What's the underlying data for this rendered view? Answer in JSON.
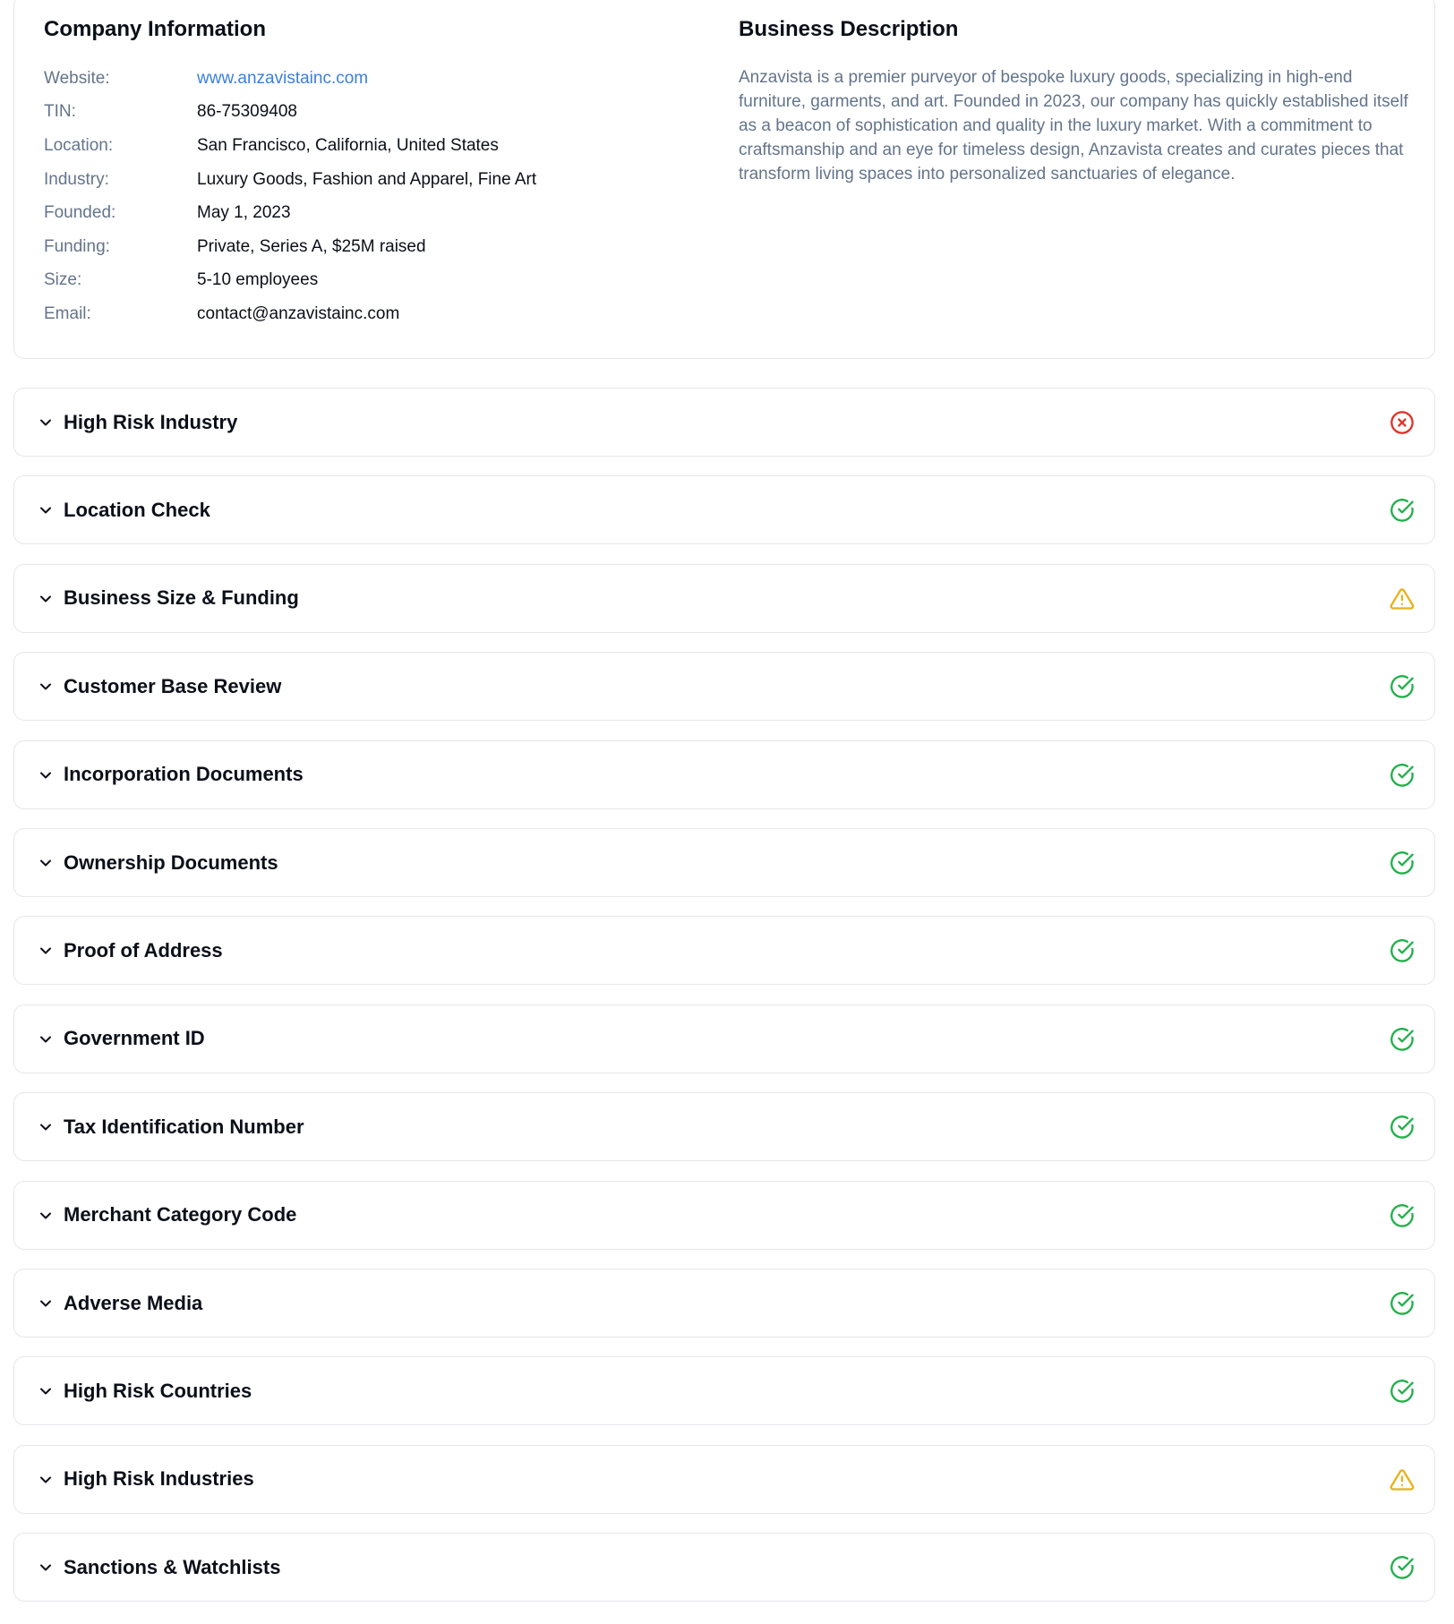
{
  "company_info": {
    "heading": "Company Information",
    "rows": [
      {
        "label": "Website:",
        "value": "www.anzavistainc.com"
      },
      {
        "label": "TIN:",
        "value": "86-75309408"
      },
      {
        "label": "Location:",
        "value": "San Francisco, California, United States"
      },
      {
        "label": "Industry:",
        "value": "Luxury Goods, Fashion and Apparel, Fine Art"
      },
      {
        "label": "Founded:",
        "value": "May 1, 2023"
      },
      {
        "label": "Funding:",
        "value": "Private, Series A, $25M raised"
      },
      {
        "label": "Size:",
        "value": "5-10 employees"
      },
      {
        "label": "Email:",
        "value": "contact@anzavistainc.com"
      }
    ]
  },
  "business_description": {
    "heading": "Business Description",
    "text": "Anzavista is a premier purveyor of bespoke luxury goods, specializing in high-end furniture, garments, and art. Founded in 2023, our company has quickly established itself as a beacon of sophistication and quality in the luxury market. With a commitment to craftsmanship and an eye for timeless design, Anzavista creates and curates pieces that transform living spaces into personalized sanctuaries of elegance."
  },
  "checks": [
    {
      "title": "High Risk Industry",
      "status": "fail",
      "icon": "x-circle-icon"
    },
    {
      "title": "Location Check",
      "status": "pass",
      "icon": "check-circle-icon"
    },
    {
      "title": "Business Size & Funding",
      "status": "warning",
      "icon": "warning-triangle-icon"
    },
    {
      "title": "Customer Base Review",
      "status": "pass",
      "icon": "check-circle-icon"
    },
    {
      "title": "Incorporation Documents",
      "status": "pass",
      "icon": "check-circle-icon"
    },
    {
      "title": "Ownership Documents",
      "status": "pass",
      "icon": "check-circle-icon"
    },
    {
      "title": "Proof of Address",
      "status": "pass",
      "icon": "check-circle-icon"
    },
    {
      "title": "Government ID",
      "status": "pass",
      "icon": "check-circle-icon"
    },
    {
      "title": "Tax Identification Number",
      "status": "pass",
      "icon": "check-circle-icon"
    },
    {
      "title": "Merchant Category Code",
      "status": "pass",
      "icon": "check-circle-icon"
    },
    {
      "title": "Adverse Media",
      "status": "pass",
      "icon": "check-circle-icon"
    },
    {
      "title": "High Risk Countries",
      "status": "pass",
      "icon": "check-circle-icon"
    },
    {
      "title": "High Risk Industries",
      "status": "warning",
      "icon": "warning-triangle-icon"
    },
    {
      "title": "Sanctions & Watchlists",
      "status": "pass",
      "icon": "check-circle-icon"
    }
  ],
  "colors": {
    "pass": "#22b04b",
    "fail": "#e0352b",
    "warning": "#e8b11c",
    "link": "#3b7fe0",
    "label": "#64748b",
    "border": "#e5e7eb"
  }
}
